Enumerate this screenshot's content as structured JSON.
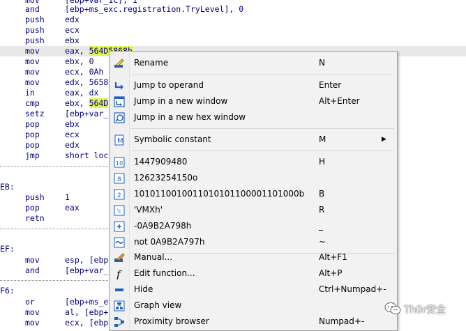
{
  "disassembly": {
    "lines": [
      {
        "mn": "mov",
        "op": "[ebp+var_1C], 1"
      },
      {
        "mn": "and",
        "op": "[ebp+ms_exc.registration.TryLevel], 0"
      },
      {
        "mn": "push",
        "op": "edx"
      },
      {
        "mn": "push",
        "op": "ecx"
      },
      {
        "mn": "push",
        "op": "ebx"
      },
      {
        "mn": "mov",
        "op_pre": "eax, ",
        "op_hl": "564D5868h"
      },
      {
        "mn": "mov",
        "op": "ebx, 0"
      },
      {
        "mn": "mov",
        "op": "ecx, 0Ah"
      },
      {
        "mn": "mov",
        "op": "edx, 5658"
      },
      {
        "mn": "in",
        "op": "eax, dx"
      },
      {
        "mn": "cmp",
        "op_pre": "ebx, ",
        "op_hl": "564D"
      },
      {
        "mn": "setz",
        "op": "[ebp+var_"
      },
      {
        "mn": "pop",
        "op": "ebx"
      },
      {
        "mn": "pop",
        "op": "ecx"
      },
      {
        "mn": "pop",
        "op": "edx"
      },
      {
        "mn": "jmp",
        "op": "short loc"
      },
      {
        "label": "EB:"
      },
      {
        "mn": "push",
        "op": "1"
      },
      {
        "mn": "pop",
        "op": "eax"
      },
      {
        "mn": "retn",
        "op": ""
      },
      {
        "label": "EF:"
      },
      {
        "mn": "mov",
        "op": "esp, [ebp"
      },
      {
        "mn": "and",
        "op": "[ebp+var_"
      },
      {
        "label": "F6:"
      },
      {
        "mn": "or",
        "op": "[ebp+ms_e"
      },
      {
        "mn": "mov",
        "op": "al, [ebp+"
      },
      {
        "mn": "mov",
        "op": "ecx, [ebp"
      }
    ]
  },
  "context_menu": {
    "items": [
      {
        "label": "Rename",
        "shortcut": "N",
        "icon": "rename-icon"
      },
      {
        "label": "Jump to operand",
        "shortcut": "Enter",
        "icon": "jump-operand-icon"
      },
      {
        "label": "Jump in a new window",
        "shortcut": "Alt+Enter",
        "icon": "new-window-icon"
      },
      {
        "label": "Jump in a new hex window",
        "shortcut": "",
        "icon": "hex-window-icon"
      },
      {
        "label": "Symbolic constant",
        "shortcut": "M",
        "icon": "symbolic-constant-icon",
        "submenu": "▶"
      },
      {
        "label": "1447909480",
        "shortcut": "H",
        "icon": "decimal-icon"
      },
      {
        "label": "12623254150o",
        "shortcut": "",
        "icon": "octal-icon"
      },
      {
        "label": "1010110010011010101100001101000b",
        "shortcut": "B",
        "icon": "binary-icon"
      },
      {
        "label": "'VMXh'",
        "shortcut": "R",
        "icon": "char-icon"
      },
      {
        "label": "-0A9B2A798h",
        "shortcut": "_",
        "icon": "negate-icon"
      },
      {
        "label": "not 0A9B2A797h",
        "shortcut": "~",
        "icon": "bitwise-not-icon"
      },
      {
        "label": "Manual...",
        "shortcut": "Alt+F1",
        "icon": "manual-icon"
      },
      {
        "label": "Edit function...",
        "shortcut": "Alt+P",
        "icon": "function-icon"
      },
      {
        "label": "Hide",
        "shortcut": "Ctrl+Numpad+-",
        "icon": "hide-icon"
      },
      {
        "label": "Graph view",
        "shortcut": "",
        "icon": "graph-view-icon"
      },
      {
        "label": "Proximity browser",
        "shortcut": "Numpad+-",
        "icon": "proximity-browser-icon"
      }
    ]
  },
  "watermark": {
    "text": "Th0r安全",
    "icon": "wechat-logo-icon"
  },
  "colors": {
    "code": "#00007f",
    "highlight": "#e2f05a",
    "current_line": "#e8e8e8",
    "icon_blue": "#1f5fbf"
  }
}
